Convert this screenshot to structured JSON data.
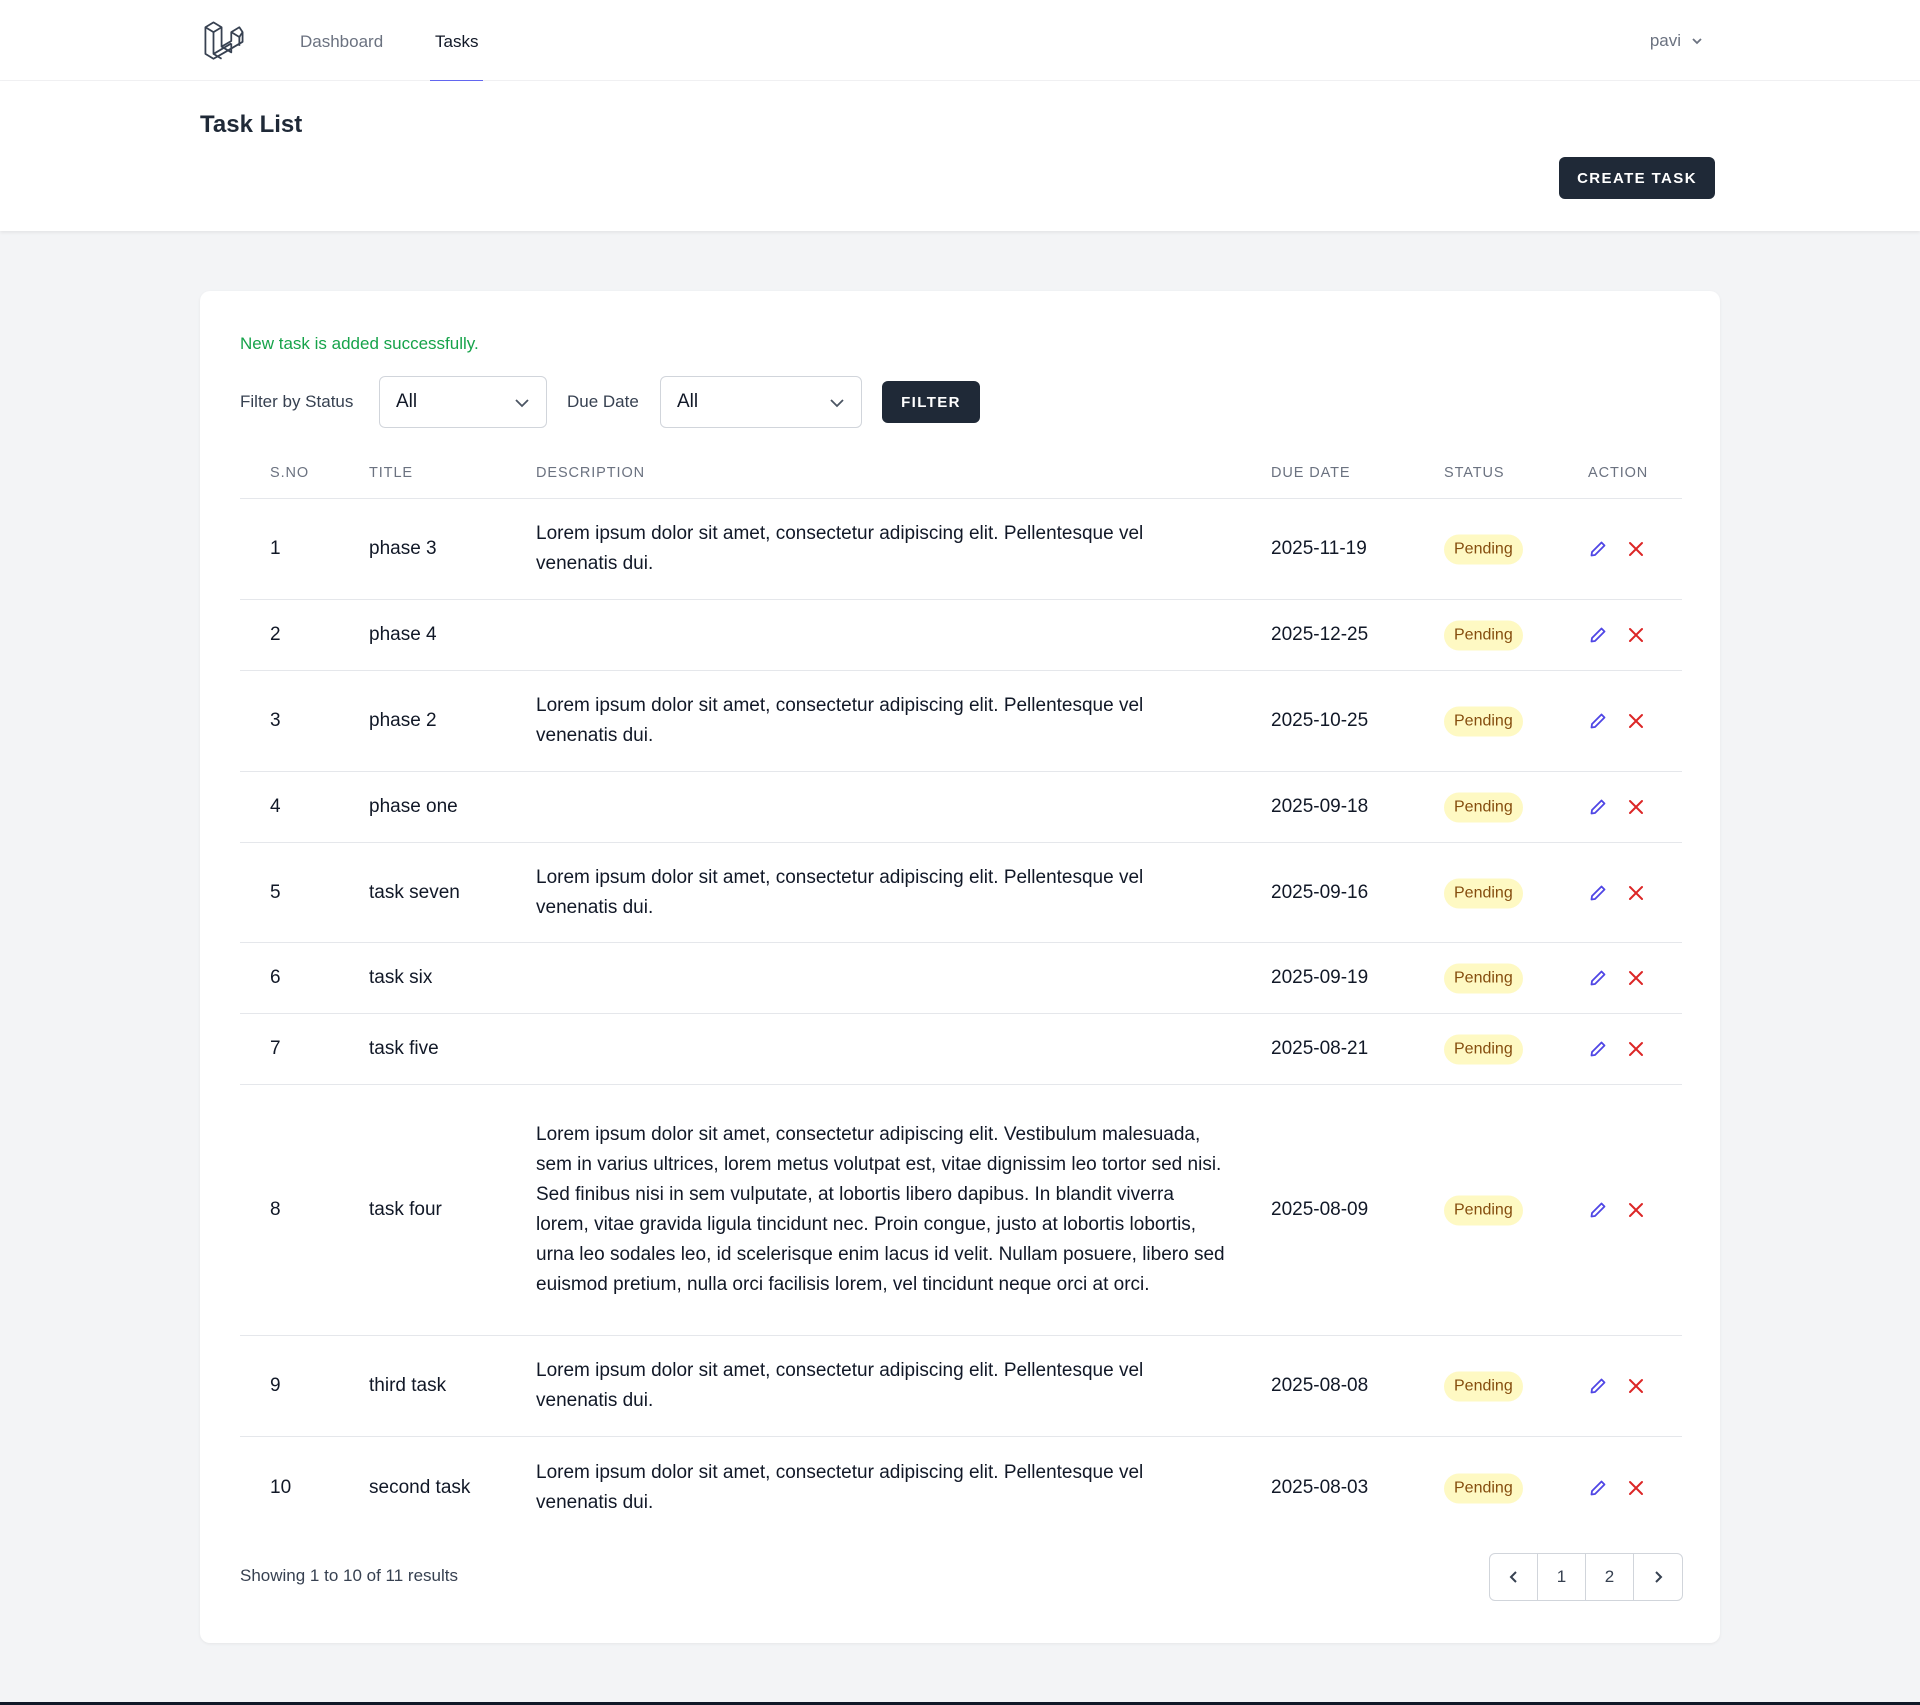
{
  "nav": {
    "logo_icon": "laravel-logo-icon",
    "links": [
      {
        "label": "Dashboard",
        "active": false
      },
      {
        "label": "Tasks",
        "active": true
      }
    ],
    "user": "pavi"
  },
  "header": {
    "title": "Task List",
    "create_label": "CREATE TASK"
  },
  "content": {
    "success_message": "New task is added successfully.",
    "filters": {
      "status_label": "Filter by Status",
      "status_value": "All",
      "due_label": "Due Date",
      "due_value": "All",
      "filter_label": "FILTER"
    },
    "table": {
      "headers": [
        "S.NO",
        "TITLE",
        "DESCRIPTION",
        "DUE DATE",
        "STATUS",
        "ACTION"
      ],
      "rows": [
        {
          "sno": "1",
          "title": "phase 3",
          "description": "Lorem ipsum dolor sit amet, consectetur adipiscing elit. Pellentesque vel venenatis dui.",
          "due": "2025-11-19",
          "status": "Pending"
        },
        {
          "sno": "2",
          "title": "phase 4",
          "description": "",
          "due": "2025-12-25",
          "status": "Pending"
        },
        {
          "sno": "3",
          "title": "phase 2",
          "description": "Lorem ipsum dolor sit amet, consectetur adipiscing elit. Pellentesque vel venenatis dui.",
          "due": "2025-10-25",
          "status": "Pending"
        },
        {
          "sno": "4",
          "title": "phase one",
          "description": "",
          "due": "2025-09-18",
          "status": "Pending"
        },
        {
          "sno": "5",
          "title": "task seven",
          "description": "Lorem ipsum dolor sit amet, consectetur adipiscing elit. Pellentesque vel venenatis dui.",
          "due": "2025-09-16",
          "status": "Pending"
        },
        {
          "sno": "6",
          "title": "task six",
          "description": "",
          "due": "2025-09-19",
          "status": "Pending"
        },
        {
          "sno": "7",
          "title": "task five",
          "description": "",
          "due": "2025-08-21",
          "status": "Pending"
        },
        {
          "sno": "8",
          "title": "task four",
          "description": "Lorem ipsum dolor sit amet, consectetur adipiscing elit. Vestibulum malesuada, sem in varius ultrices, lorem metus volutpat est, vitae dignissim leo tortor sed nisi. Sed finibus nisi in sem vulputate, at lobortis libero dapibus. In blandit viverra lorem, vitae gravida ligula tincidunt nec. Proin congue, justo at lobortis lobortis, urna leo sodales leo, id scelerisque enim lacus id velit. Nullam posuere, libero sed euismod pretium, nulla orci facilisis lorem, vel tincidunt neque orci at orci.",
          "due": "2025-08-09",
          "status": "Pending"
        },
        {
          "sno": "9",
          "title": "third task",
          "description": "Lorem ipsum dolor sit amet, consectetur adipiscing elit. Pellentesque vel venenatis dui.",
          "due": "2025-08-08",
          "status": "Pending"
        },
        {
          "sno": "10",
          "title": "second task",
          "description": "Lorem ipsum dolor sit amet, consectetur adipiscing elit. Pellentesque vel venenatis dui.",
          "due": "2025-08-03",
          "status": "Pending"
        }
      ]
    },
    "showing": "Showing 1 to 10 of 11 results",
    "pagination": {
      "pages": [
        "1",
        "2"
      ]
    }
  },
  "colors": {
    "primary_button": "#1f2937",
    "success_text": "#16a34a",
    "badge_bg": "#fef9c3",
    "badge_text": "#854d0e",
    "edit_icon": "#4f46e5",
    "delete_icon": "#dc2626",
    "active_tab_underline": "#6366f1"
  }
}
